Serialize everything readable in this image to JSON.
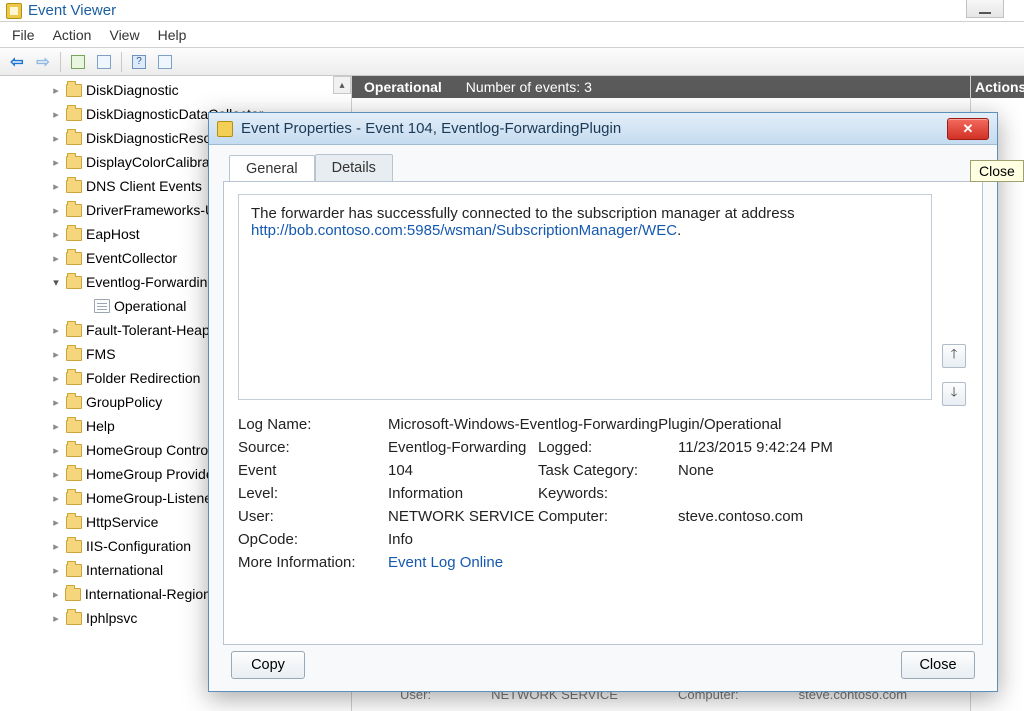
{
  "window": {
    "title": "Event Viewer"
  },
  "menu": {
    "file": "File",
    "action": "Action",
    "view": "View",
    "help": "Help"
  },
  "tree": {
    "items": [
      {
        "label": "DiskDiagnostic"
      },
      {
        "label": "DiskDiagnosticDataCollector"
      },
      {
        "label": "DiskDiagnosticResolver"
      },
      {
        "label": "DisplayColorCalibration"
      },
      {
        "label": "DNS Client Events"
      },
      {
        "label": "DriverFrameworks-UserMode"
      },
      {
        "label": "EapHost"
      },
      {
        "label": "EventCollector"
      },
      {
        "label": "Eventlog-ForwardingPlugin",
        "expanded": true,
        "child": "Operational"
      },
      {
        "label": "Fault-Tolerant-Heap"
      },
      {
        "label": "FMS"
      },
      {
        "label": "Folder Redirection"
      },
      {
        "label": "GroupPolicy"
      },
      {
        "label": "Help"
      },
      {
        "label": "HomeGroup Control Panel"
      },
      {
        "label": "HomeGroup Provider Service"
      },
      {
        "label": "HomeGroup-ListenerService"
      },
      {
        "label": "HttpService"
      },
      {
        "label": "IIS-Configuration"
      },
      {
        "label": "International"
      },
      {
        "label": "International-RegionalOptionsControlPanel"
      },
      {
        "label": "Iphlpsvc"
      }
    ]
  },
  "events_header": {
    "title": "Operational",
    "count_label": "Number of events: 3"
  },
  "actions_header": "Actions",
  "tooltip": "Close",
  "dialog": {
    "title": "Event Properties - Event 104, Eventlog-ForwardingPlugin",
    "tabs": {
      "general": "General",
      "details": "Details"
    },
    "desc_text": "The forwarder has successfully connected to the subscription manager at address ",
    "desc_link": "http://bob.contoso.com:5985/wsman/SubscriptionManager/WEC",
    "fields": {
      "log_name_lbl": "Log Name:",
      "log_name": "Microsoft-Windows-Eventlog-ForwardingPlugin/Operational",
      "source_lbl": "Source:",
      "source": "Eventlog-Forwarding",
      "logged_lbl": "Logged:",
      "logged": "11/23/2015 9:42:24 PM",
      "event_lbl": "Event",
      "event": "104",
      "task_lbl": "Task Category:",
      "task": "None",
      "level_lbl": "Level:",
      "level": "Information",
      "keywords_lbl": "Keywords:",
      "keywords": "",
      "user_lbl": "User:",
      "user": "NETWORK SERVICE",
      "computer_lbl": "Computer:",
      "computer": "steve.contoso.com",
      "opcode_lbl": "OpCode:",
      "opcode": "Info",
      "moreinfo_lbl": "More Information:",
      "moreinfo_link": "Event Log Online"
    },
    "buttons": {
      "copy": "Copy",
      "close": "Close"
    }
  },
  "bg_row": {
    "user_lbl": "User:",
    "user": "NETWORK SERVICE",
    "comp_lbl": "Computer:",
    "comp": "steve.contoso.com"
  }
}
